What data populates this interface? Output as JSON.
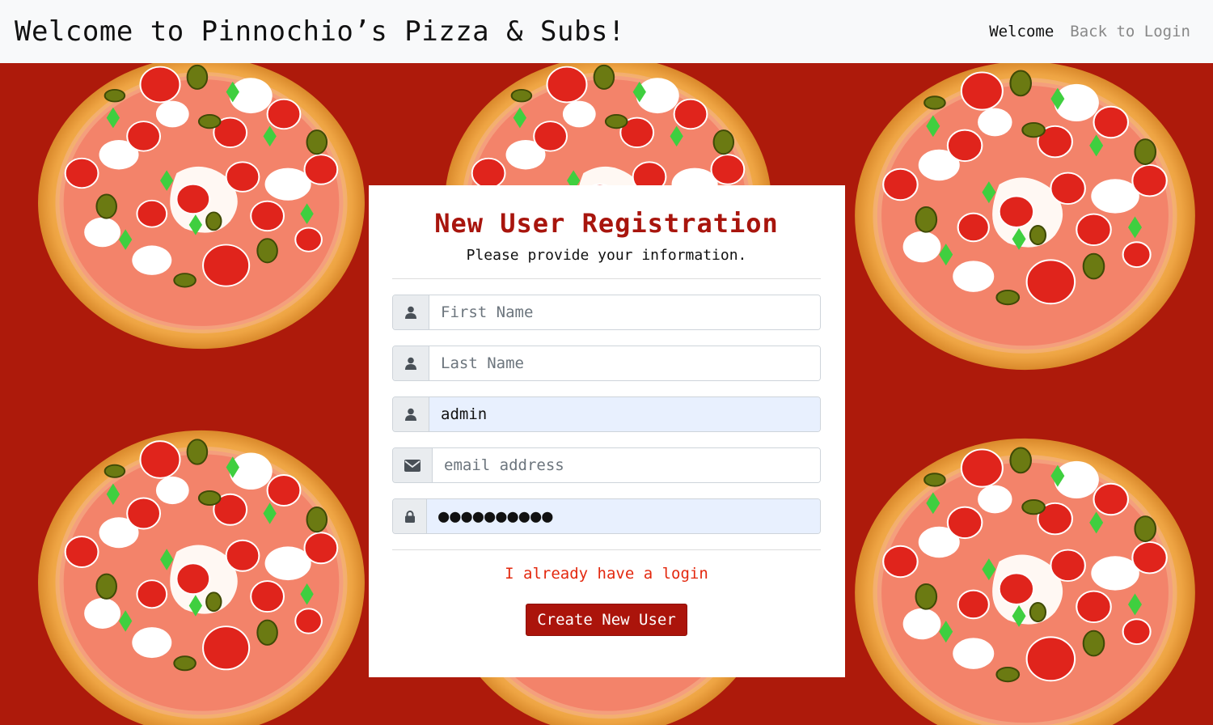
{
  "navbar": {
    "brand": "Welcome to Pinnochio’s Pizza & Subs!",
    "links": [
      "Welcome",
      "Back to Login"
    ]
  },
  "form": {
    "title": "New User Registration",
    "subtitle": "Please provide your information.",
    "first_name": {
      "placeholder": "First Name",
      "value": "",
      "icon": "user-icon"
    },
    "last_name": {
      "placeholder": "Last Name",
      "value": "",
      "icon": "user-icon"
    },
    "username": {
      "placeholder": "",
      "value": "admin",
      "icon": "user-icon"
    },
    "email": {
      "placeholder": "email address",
      "value": "",
      "icon": "envelope-icon"
    },
    "password": {
      "placeholder": "",
      "value": "●●●●●●●●●●",
      "icon": "lock-icon"
    },
    "login_link": "I already have a login",
    "submit_label": "Create New User"
  },
  "colors": {
    "background": "#ad1a0b",
    "accent": "#a8150d",
    "link": "#e3280e",
    "autofill": "#e8f0fe"
  }
}
